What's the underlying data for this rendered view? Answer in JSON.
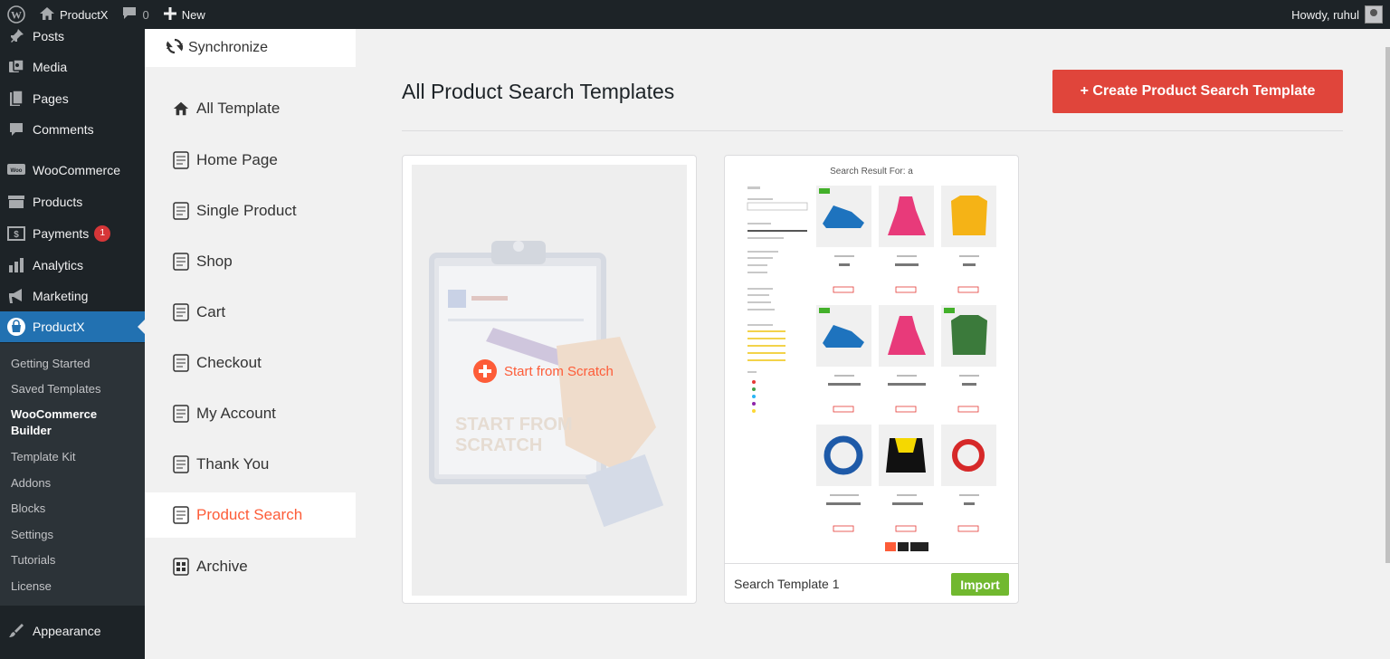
{
  "adminbar": {
    "site_name": "ProductX",
    "comments_count": "0",
    "new_label": "New",
    "howdy": "Howdy, ruhul"
  },
  "sidebar": {
    "items": [
      {
        "label": "Posts",
        "icon": "pin-icon"
      },
      {
        "label": "Media",
        "icon": "media-icon"
      },
      {
        "label": "Pages",
        "icon": "pages-icon"
      },
      {
        "label": "Comments",
        "icon": "comment-icon"
      },
      {
        "label": "WooCommerce",
        "icon": "woo-icon"
      },
      {
        "label": "Products",
        "icon": "archive-icon"
      },
      {
        "label": "Payments",
        "icon": "dollar-icon",
        "badge": "1"
      },
      {
        "label": "Analytics",
        "icon": "chart-icon"
      },
      {
        "label": "Marketing",
        "icon": "megaphone-icon"
      },
      {
        "label": "ProductX",
        "icon": "bag-icon"
      }
    ],
    "submenu": [
      "Getting Started",
      "Saved Templates",
      "WooCommerce Builder",
      "Template Kit",
      "Addons",
      "Blocks",
      "Settings",
      "Tutorials",
      "License"
    ],
    "appearance": "Appearance"
  },
  "builder_nav": {
    "synchronize": "Synchronize",
    "items": [
      "All Template",
      "Home Page",
      "Single Product",
      "Shop",
      "Cart",
      "Checkout",
      "My Account",
      "Thank You",
      "Product Search",
      "Archive"
    ]
  },
  "main": {
    "title": "All Product Search Templates",
    "create_button": "+ Create Product Search Template",
    "scratch_label": "Start from Scratch",
    "scratch_watermark_1": "START FROM",
    "scratch_watermark_2": "SCRATCH",
    "template": {
      "name": "Search Template 1",
      "import_label": "Import",
      "preview_title": "Search Result For: a"
    }
  },
  "colors": {
    "admin_bg": "#1d2327",
    "active_blue": "#2271b1",
    "accent_orange": "#fd5c38",
    "create_red": "#e0453b",
    "import_green": "#71b82f"
  }
}
